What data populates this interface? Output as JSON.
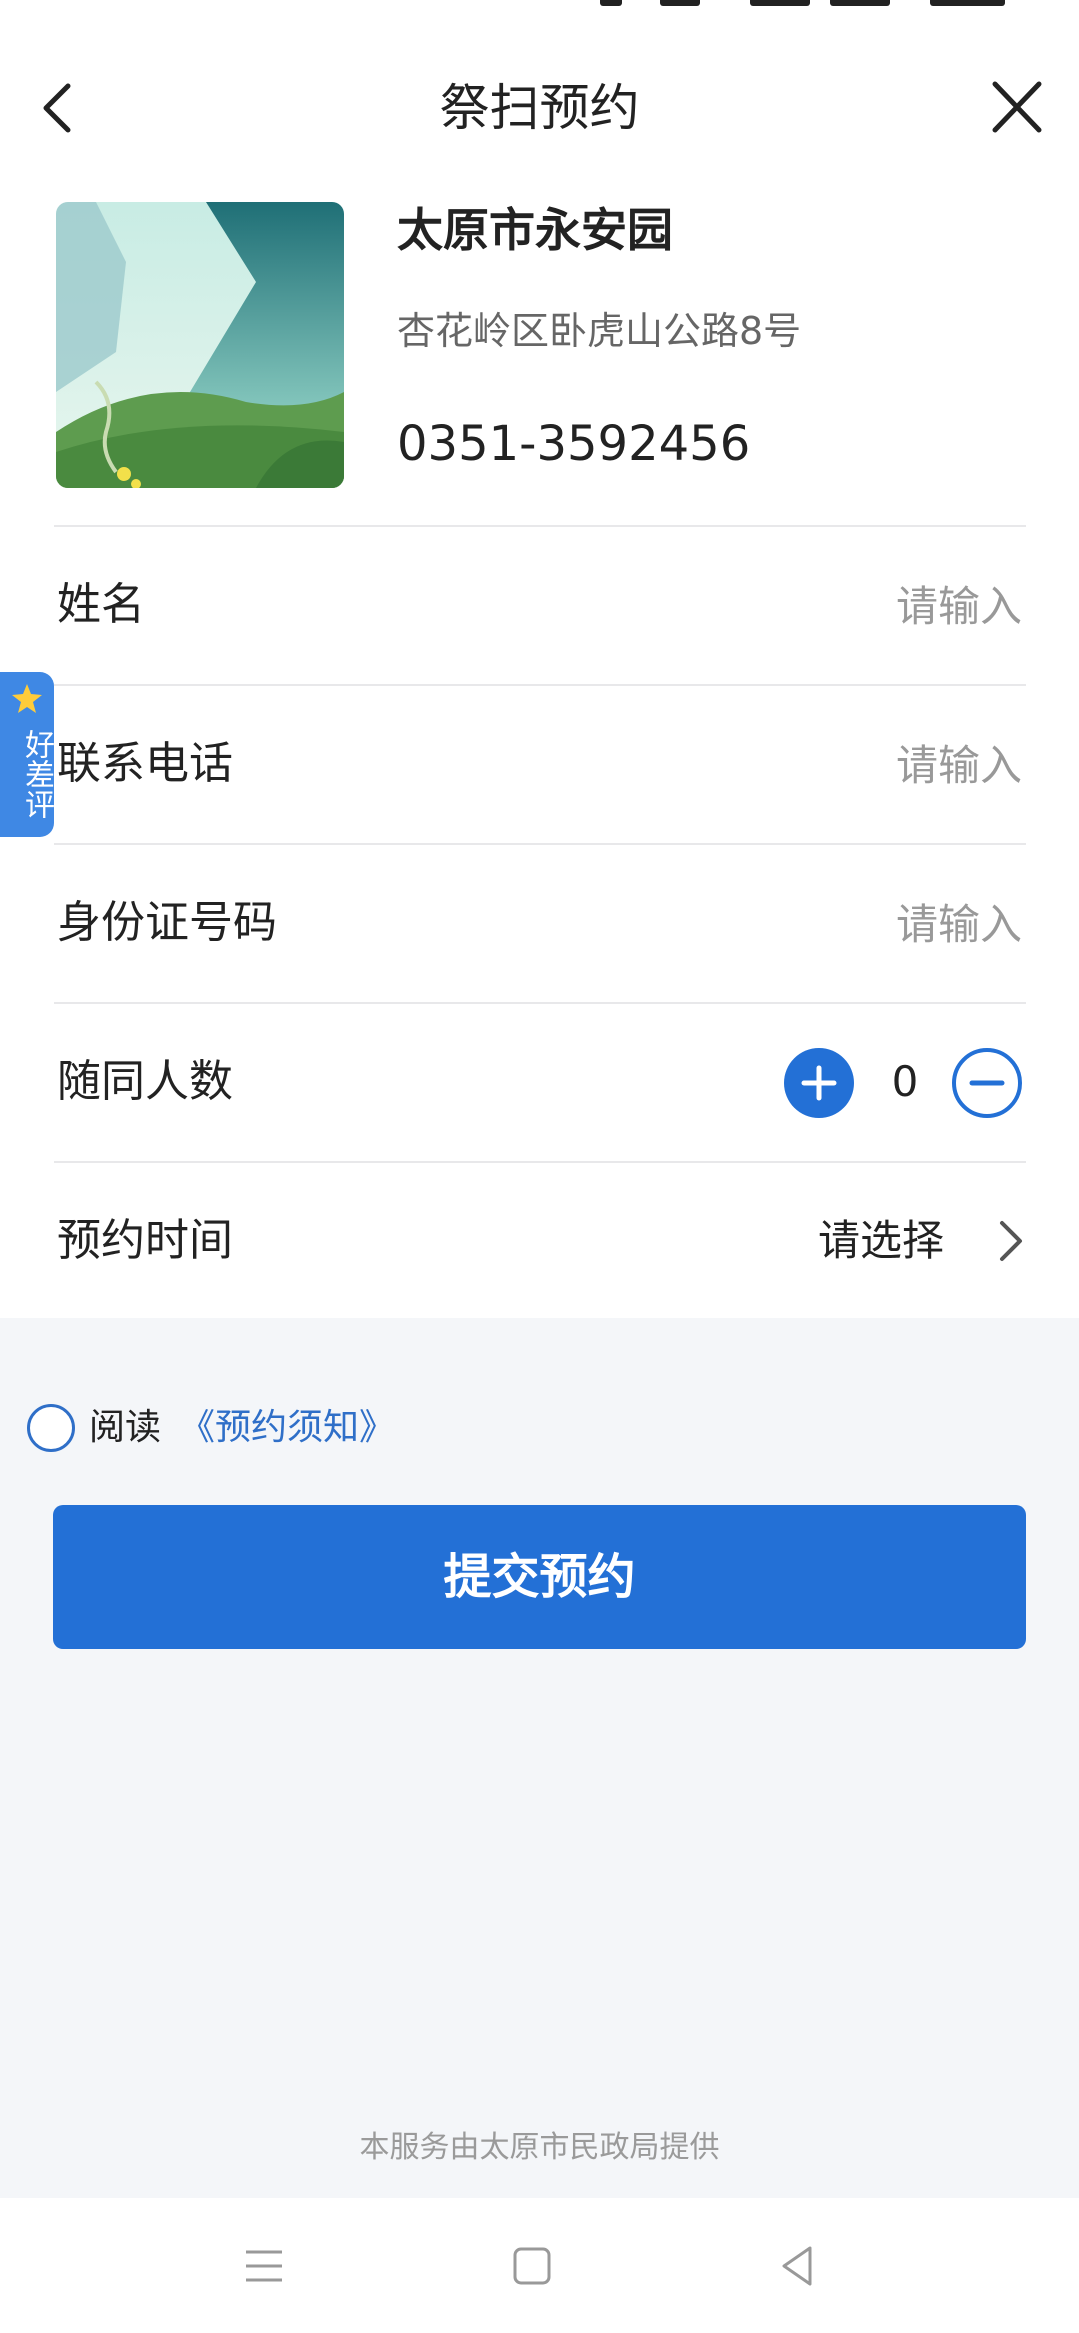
{
  "navbar": {
    "title": "祭扫预约"
  },
  "venue": {
    "name": "太原市永安园",
    "address": "杏花岭区卧虎山公路8号",
    "phone": "0351-3592456"
  },
  "form": {
    "name_label": "姓名",
    "name_placeholder": "请输入",
    "phone_label": "联系电话",
    "phone_placeholder": "请输入",
    "id_label": "身份证号码",
    "id_placeholder": "请输入",
    "companions_label": "随同人数",
    "companions_value": "0",
    "time_label": "预约时间",
    "time_value": "请选择"
  },
  "float_tab": {
    "label": "好差评"
  },
  "agreement": {
    "prefix": "阅读",
    "link": "《预约须知》",
    "checked": false
  },
  "submit_label": "提交预约",
  "footer": "本服务由太原市民政局提供",
  "colors": {
    "primary": "#2370d6",
    "link": "#2f6fc8",
    "page_bg": "#f4f6f9"
  }
}
